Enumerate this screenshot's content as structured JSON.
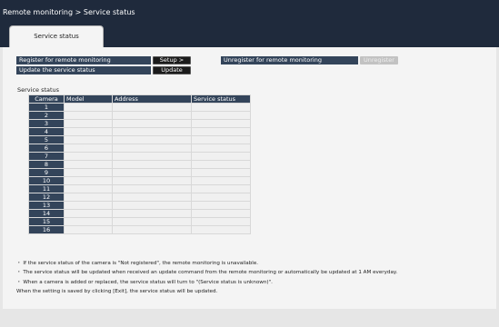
{
  "window": {
    "title": "Remote monitoring > Service status"
  },
  "tabs": [
    {
      "label": "Service status"
    }
  ],
  "actions": {
    "register_label": "Register for remote monitoring",
    "setup_button": "Setup >",
    "update_label": "Update the service status",
    "update_button": "Update",
    "unregister_label": "Unregister for remote monitoring",
    "unregister_button": "Unregister"
  },
  "service_status": {
    "title": "Service status",
    "columns": [
      "Camera",
      "Model",
      "Address",
      "Service status"
    ],
    "cameras": [
      "1",
      "2",
      "3",
      "4",
      "5",
      "6",
      "7",
      "8",
      "9",
      "10",
      "11",
      "12",
      "13",
      "14",
      "15",
      "16"
    ]
  },
  "notes": [
    "・ If the service status of the camera is \"Not registered\", the remote monitoring is unavailable.",
    "・ The service status will be updated when received an update command from the remote monitoring or automatically be updated at 1 AM everyday.",
    "・ When a camera is added or replaced, the service status will turn to \"(Service status is unknown)\".",
    "   When the setting is saved by clicking [Exit], the service status will be updated."
  ]
}
